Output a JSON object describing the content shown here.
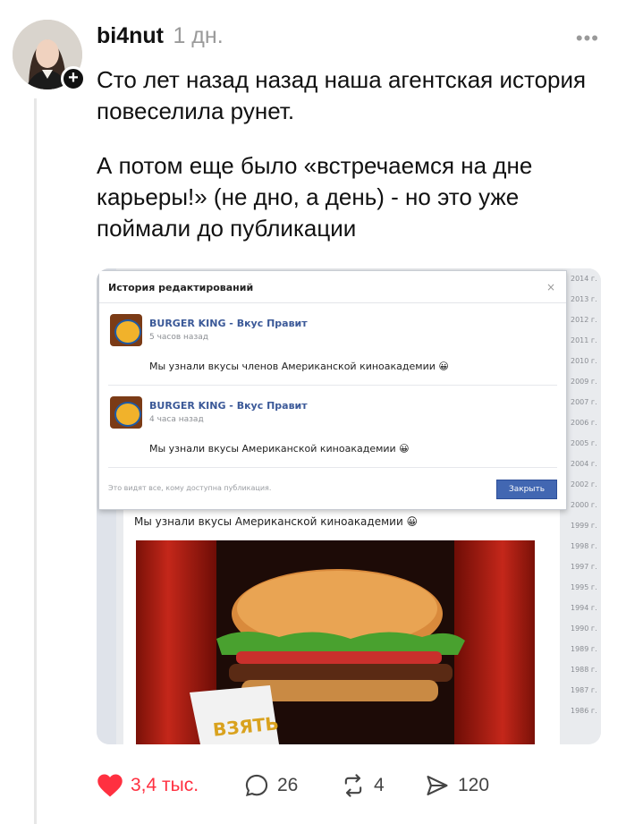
{
  "post": {
    "username": "bi4nut",
    "time": "1 дн.",
    "more_icon": "more-dots-icon",
    "paragraph1": "Сто лет назад назад наша агентская история повеселила рунет.",
    "paragraph2": "А потом еще было «встречаемся на дне карьеры!» (не дно, а день) - но это уже поймали до публикации"
  },
  "screenshot": {
    "dialog_title": "История редактирований",
    "close_icon": "×",
    "entries": [
      {
        "name": "BURGER KING - Вкус Правит",
        "time": "5 часов назад",
        "message": "Мы узнали вкусы членов Американской киноакадемии 😀"
      },
      {
        "name": "BURGER KING - Вкус Правит",
        "time": "4 часа назад",
        "message": "Мы узнали вкусы Американской киноакадемии 😀"
      }
    ],
    "footer_note": "Это видят все, кому доступна публикация.",
    "close_button": "Закрыть",
    "post_caption": "Мы узнали вкусы Американской киноакадемии 😀",
    "years": [
      "2014 г.",
      "2013 г.",
      "2012 г.",
      "2011 г.",
      "2010 г.",
      "2009 г.",
      "2007 г.",
      "2006 г.",
      "2005 г.",
      "2004 г.",
      "2002 г.",
      "2000 г.",
      "1999 г.",
      "1998 г.",
      "1997 г.",
      "1995 г.",
      "1994 г.",
      "1990 г.",
      "1989 г.",
      "1988 г.",
      "1987 г.",
      "1986 г."
    ],
    "sign_text": "ВЗЯТЬ"
  },
  "actions": {
    "likes": "3,4 тыс.",
    "comments": "26",
    "reposts": "4",
    "shares": "120"
  },
  "colors": {
    "like": "#ff3040",
    "facebook_blue": "#3b5998"
  }
}
